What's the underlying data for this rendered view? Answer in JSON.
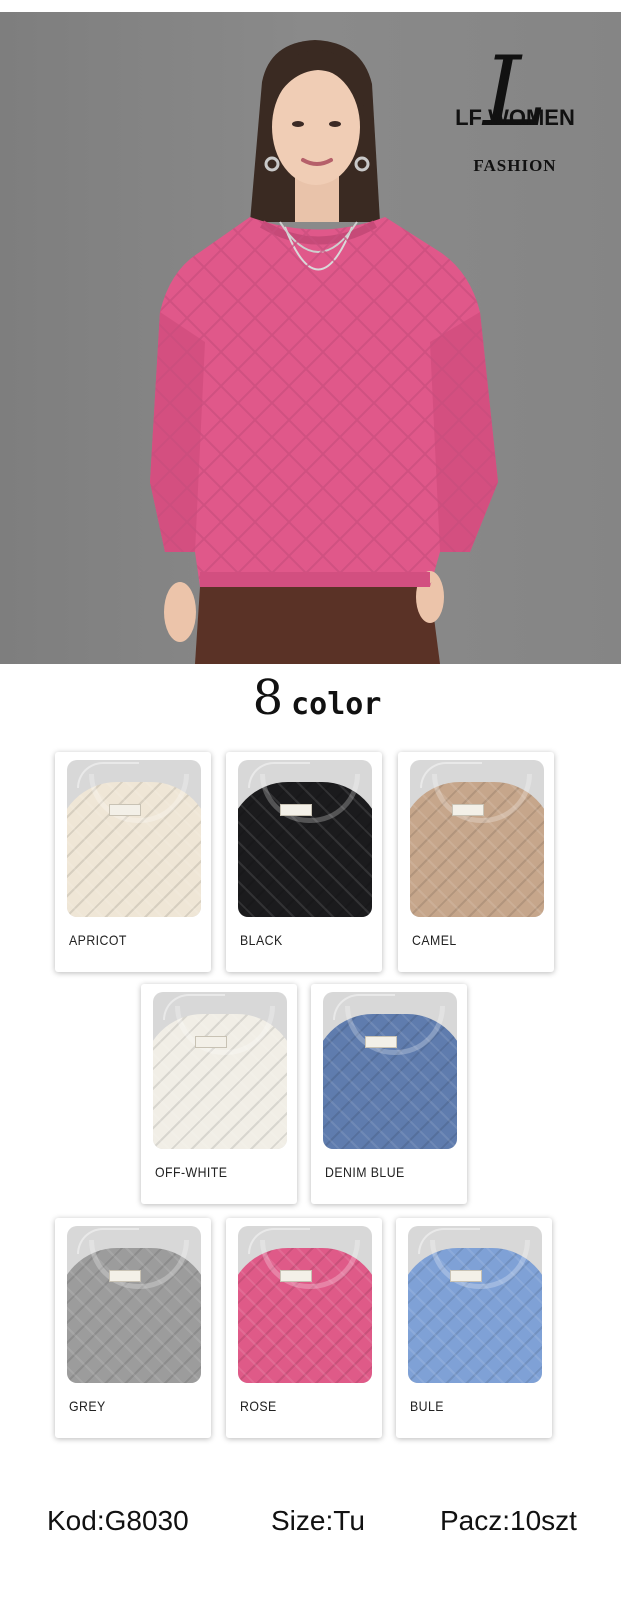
{
  "brand": {
    "mark": "L",
    "name": "LF WOMEN",
    "tagline": "FASHION"
  },
  "color_heading": {
    "count": "8",
    "word": "color"
  },
  "colors": [
    {
      "label": "APRICOT",
      "color": "#efe6d6"
    },
    {
      "label": "BLACK",
      "color": "#1b1b1d"
    },
    {
      "label": "CAMEL",
      "color": "#c6a68b"
    },
    {
      "label": "OFF-WHITE",
      "color": "#f1eee6"
    },
    {
      "label": "DENIM BLUE",
      "color": "#5f7cae"
    },
    {
      "label": "GREY",
      "color": "#9c9c9c"
    },
    {
      "label": "ROSE",
      "color": "#df5a88"
    },
    {
      "label": "BULE",
      "color": "#7fa1d6"
    }
  ],
  "footer": {
    "code": "Kod:G8030",
    "size": "Size:Tu",
    "pack": "Pacz:10szt"
  },
  "hero_sweater_color": "#e0588a"
}
